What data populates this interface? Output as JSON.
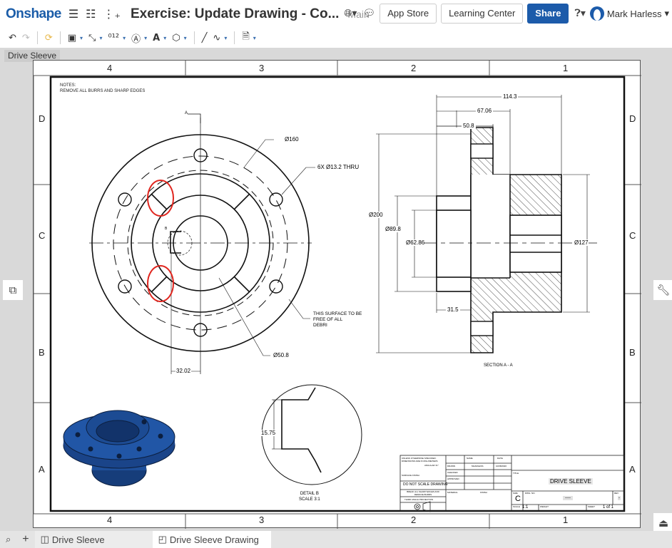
{
  "app": {
    "logo": "Onshape",
    "doc_title": "Exercise: Update Drawing - Co...",
    "branch": "Main"
  },
  "header": {
    "app_store": "App Store",
    "learning_center": "Learning Center",
    "share": "Share",
    "user": "Mark Harless",
    "caret": "▾"
  },
  "toolbar": {
    "undo": "↶",
    "redo": "↷",
    "caret": "▾"
  },
  "sheet_tab": "Drive Sleeve",
  "zones": {
    "cols": [
      "4",
      "3",
      "2",
      "1"
    ],
    "rows": [
      "D",
      "C",
      "B",
      "A"
    ]
  },
  "drawing": {
    "notes_title": "NOTES:",
    "notes_body": "REMOVE ALL BURRS AND SHARP EDGES",
    "section_marker": "A",
    "detail_marker": "B",
    "dims": {
      "d160": "Ø160",
      "holes": "6X Ø13.2 THRU",
      "surface_note_1": "THIS SURFACE TO BE",
      "surface_note_2": "FREE OF ALL",
      "surface_note_3": "DEBRI",
      "d50_8": "Ø50.8",
      "w32_02": "32.02",
      "l114_3": "114.3",
      "l67_06": "67.06",
      "l50_8": "50.8",
      "d200": "Ø200",
      "d89_8": "Ø89.8",
      "d62_86": "Ø62.86",
      "d127": "Ø127",
      "l31_5": "31.5",
      "d15_75": "15.75"
    },
    "section_label": "SECTION A - A",
    "detail_label_1": "DETAIL B",
    "detail_label_2": "SCALE 3:1"
  },
  "title_block": {
    "tolerance_note": "UNLESS OTHERWISE SPECIFIED: DIMENSIONS ARE IN MILLIMETERS",
    "angular": "ANGULAR ±1°",
    "surface_finish": "SURFACE FINISH",
    "no_scale": "DO NOT SCALE DRAWING",
    "break_edges": "BREAK ALL SHARP EDGES AND REMOVE BURRS",
    "projection": "THIRD ANGLE PROJECTION",
    "name_hdr": "NAME",
    "date_hdr": "DATE",
    "drawn": "DRAWN",
    "checked": "CHECKED",
    "approved": "APPROVED",
    "drawn_name": "MHARLESS",
    "drawn_date": "10/08/2020",
    "material": "MATERIAL",
    "finish": "FINISH",
    "title_lbl": "TITLE",
    "title": "DRIVE SLEEVE",
    "size_lbl": "SIZE",
    "size": "C",
    "dwg_lbl": "DWG. NO.",
    "dwg_no": "----",
    "rev_lbl": "REV",
    "rev": "-",
    "scale_lbl": "SCALE",
    "scale": "1:1",
    "weight_lbl": "WEIGHT",
    "sheet_lbl": "SHEET",
    "sheet": "1 of 1"
  },
  "bottom_tabs": [
    {
      "label": "Drive Sleeve"
    },
    {
      "label": "Drive Sleeve Drawing"
    }
  ],
  "colors": {
    "brand": "#1c5baa",
    "highlight": "#e0261f",
    "part": "#1e4f9a"
  }
}
